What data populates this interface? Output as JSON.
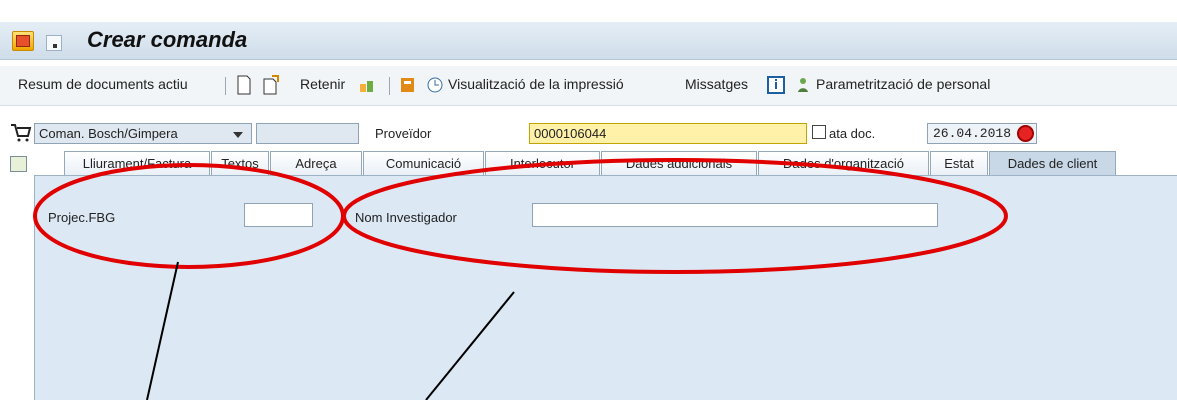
{
  "window": {
    "title": "Crear comanda"
  },
  "toolbar": {
    "summary": "Resum de documents actiu",
    "hold": "Retenir",
    "print_preview": "Visualització de la impressió",
    "messages": "Missatges",
    "personal_settings": "Parametrització de personal"
  },
  "header": {
    "doc_type": "Coman. Bosch/Gimpera",
    "vendor_label": "Proveïdor",
    "vendor_value": "0000106044",
    "date_label": "ata doc.",
    "date_value": "26.04.2018"
  },
  "tabs": [
    {
      "label": "Lliurament/Factura"
    },
    {
      "label": "Textos"
    },
    {
      "label": "Adreça"
    },
    {
      "label": "Comunicació"
    },
    {
      "label": "Interlocutor"
    },
    {
      "label": "Dades addicionals"
    },
    {
      "label": "Dades d'organització"
    },
    {
      "label": "Estat"
    },
    {
      "label": "Dades de client"
    }
  ],
  "fields": {
    "project_label": "Projec.FBG",
    "project_value": "",
    "investigator_label": "Nom Investigador",
    "investigator_value": ""
  },
  "colors": {
    "annotation": "#e00000",
    "active_tab": "#c8d8e6",
    "panel": "#dce8f3"
  },
  "icons": [
    "app-icon",
    "menu-icon",
    "new-document-icon",
    "copy-document-icon",
    "hold-icon",
    "export-icon",
    "print-preview-icon",
    "info-icon",
    "personal-settings-icon",
    "shopping-cart-icon",
    "calendar-icon",
    "tab-nav-icon"
  ]
}
